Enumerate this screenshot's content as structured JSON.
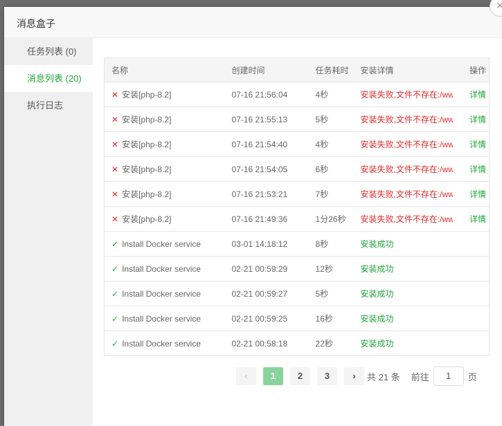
{
  "dialog": {
    "title": "消息盒子",
    "close_glyph": "×"
  },
  "sidebar": {
    "items": [
      {
        "label": "任务列表 (0)"
      },
      {
        "label": "消息列表 (20)"
      },
      {
        "label": "执行日志"
      }
    ]
  },
  "table": {
    "headers": [
      "名称",
      "创建时间",
      "任务耗时",
      "安装详情",
      "操作"
    ],
    "rows": [
      {
        "status": "fail",
        "name": "安装[php-8.2]",
        "created": "07-16 21:56:04",
        "duration": "4秒",
        "detail": "安装失败,文件不存在:/ww",
        "action": "详情"
      },
      {
        "status": "fail",
        "name": "安装[php-8.2]",
        "created": "07-16 21:55:13",
        "duration": "5秒",
        "detail": "安装失败,文件不存在:/ww",
        "action": "详情"
      },
      {
        "status": "fail",
        "name": "安装[php-8.2]",
        "created": "07-16 21:54:40",
        "duration": "4秒",
        "detail": "安装失败,文件不存在:/ww",
        "action": "详情"
      },
      {
        "status": "fail",
        "name": "安装[php-8.2]",
        "created": "07-16 21:54:05",
        "duration": "6秒",
        "detail": "安装失败,文件不存在:/ww",
        "action": "详情"
      },
      {
        "status": "fail",
        "name": "安装[php-8.2]",
        "created": "07-16 21:53:21",
        "duration": "7秒",
        "detail": "安装失败,文件不存在:/ww",
        "action": "详情"
      },
      {
        "status": "fail",
        "name": "安装[php-8.2]",
        "created": "07-16 21:49:36",
        "duration": "1分26秒",
        "detail": "安装失败,文件不存在:/ww",
        "action": "详情"
      },
      {
        "status": "ok",
        "name": "Install Docker service",
        "created": "03-01 14:18:12",
        "duration": "8秒",
        "detail": "安装成功",
        "action": ""
      },
      {
        "status": "ok",
        "name": "Install Docker service",
        "created": "02-21 00:59:29",
        "duration": "12秒",
        "detail": "安装成功",
        "action": ""
      },
      {
        "status": "ok",
        "name": "Install Docker service",
        "created": "02-21 00:59:27",
        "duration": "5秒",
        "detail": "安装成功",
        "action": ""
      },
      {
        "status": "ok",
        "name": "Install Docker service",
        "created": "02-21 00:59:25",
        "duration": "16秒",
        "detail": "安装成功",
        "action": ""
      },
      {
        "status": "ok",
        "name": "Install Docker service",
        "created": "02-21 00:58:18",
        "duration": "22秒",
        "detail": "安装成功",
        "action": ""
      }
    ]
  },
  "pagination": {
    "prev_glyph": "‹",
    "next_glyph": "›",
    "pages": [
      "1",
      "2",
      "3"
    ],
    "current": "1",
    "total_text": "共 21 条",
    "goto_label": "前往",
    "goto_value": "1",
    "page_suffix": "页"
  },
  "colors": {
    "accent": "#20a53a",
    "error": "#e42a2a"
  }
}
